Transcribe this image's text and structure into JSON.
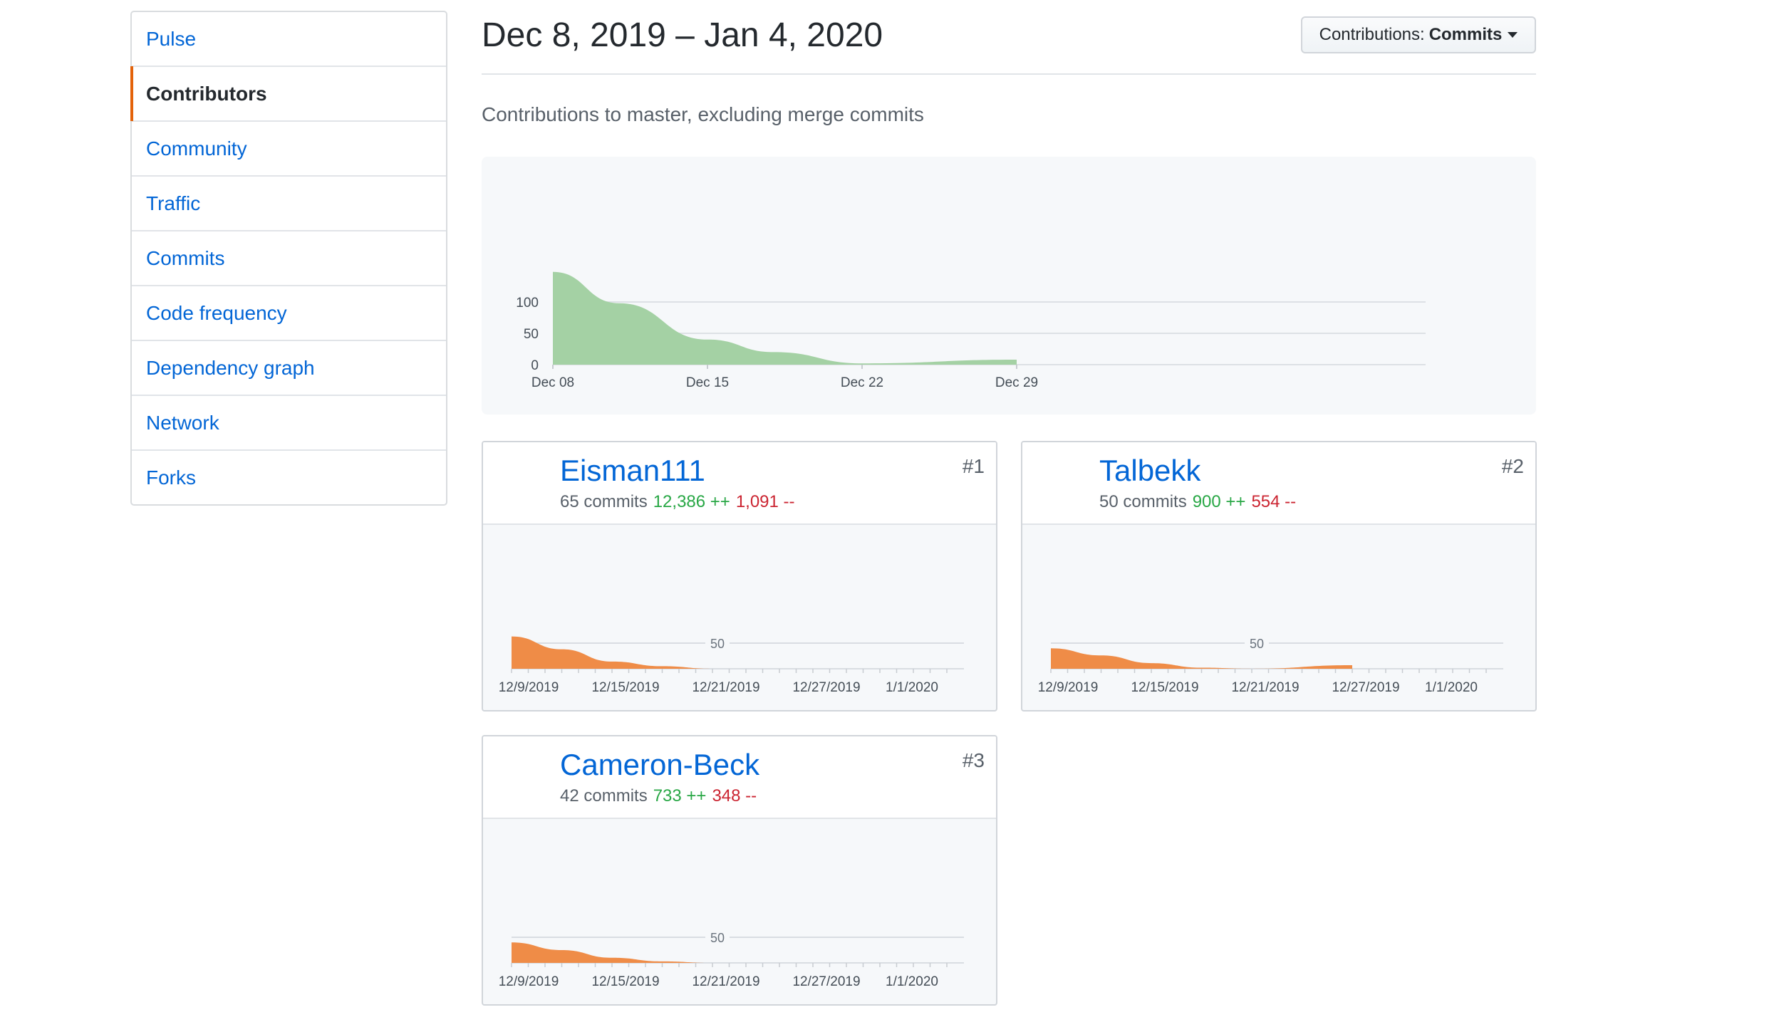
{
  "sidebar": {
    "items": [
      {
        "label": "Pulse",
        "name": "sidebar-item-pulse",
        "selected": false
      },
      {
        "label": "Contributors",
        "name": "sidebar-item-contributors",
        "selected": true
      },
      {
        "label": "Community",
        "name": "sidebar-item-community",
        "selected": false
      },
      {
        "label": "Traffic",
        "name": "sidebar-item-traffic",
        "selected": false
      },
      {
        "label": "Commits",
        "name": "sidebar-item-commits",
        "selected": false
      },
      {
        "label": "Code frequency",
        "name": "sidebar-item-code-frequency",
        "selected": false
      },
      {
        "label": "Dependency graph",
        "name": "sidebar-item-dependency-graph",
        "selected": false
      },
      {
        "label": "Network",
        "name": "sidebar-item-network",
        "selected": false
      },
      {
        "label": "Forks",
        "name": "sidebar-item-forks",
        "selected": false
      }
    ],
    "accent_color": "#e36209"
  },
  "header": {
    "date_range": "Dec 8, 2019 – Jan 4, 2020",
    "select_prefix": "Contributions:",
    "select_value": "Commits"
  },
  "subtitle": "Contributions to master, excluding merge commits",
  "colors": {
    "main_area": "#a4d1a4",
    "contributor_area": "#ef8c47",
    "link": "#0366d6",
    "additions": "#28a745",
    "deletions": "#cb2431"
  },
  "chart_data": [
    {
      "type": "area",
      "x_ticks": [
        "Dec 08",
        "Dec 15",
        "Dec 22",
        "Dec 29"
      ],
      "y_ticks": [
        "0",
        "50",
        "100"
      ],
      "ylim": [
        0,
        150
      ],
      "x": [
        0,
        3,
        7,
        10,
        14,
        21
      ],
      "values": [
        148,
        98,
        40,
        20,
        2,
        8
      ]
    },
    {
      "type": "area",
      "contributor": "Eisman111",
      "x_ticks": [
        "12/9/2019",
        "12/15/2019",
        "12/21/2019",
        "12/27/2019",
        "1/1/2020"
      ],
      "y_ticks": [
        "50"
      ],
      "ylim": [
        0,
        50
      ],
      "x": [
        0,
        3,
        6,
        9,
        12,
        24
      ],
      "values": [
        63,
        38,
        14,
        5,
        0,
        0
      ]
    },
    {
      "type": "area",
      "contributor": "Talbekk",
      "x_ticks": [
        "12/9/2019",
        "12/15/2019",
        "12/21/2019",
        "12/27/2019",
        "1/1/2020"
      ],
      "y_ticks": [
        "50"
      ],
      "ylim": [
        0,
        50
      ],
      "x": [
        0,
        3,
        6,
        9,
        12,
        18
      ],
      "values": [
        40,
        26,
        11,
        2,
        0,
        7
      ]
    },
    {
      "type": "area",
      "contributor": "Cameron-Beck",
      "x_ticks": [
        "12/9/2019",
        "12/15/2019",
        "12/21/2019",
        "12/27/2019",
        "1/1/2020"
      ],
      "y_ticks": [
        "50"
      ],
      "ylim": [
        0,
        50
      ],
      "x": [
        0,
        3,
        6,
        9,
        12,
        24
      ],
      "values": [
        40,
        25,
        10,
        3,
        0,
        0
      ]
    }
  ],
  "contributors": [
    {
      "login": "Eisman111",
      "commits": "65 commits",
      "additions": "12,386 ++",
      "deletions": "1,091 --",
      "rank": "#1",
      "avatar_icon": "photo-avatar-icon"
    },
    {
      "login": "Talbekk",
      "commits": "50 commits",
      "additions": "900 ++",
      "deletions": "554 --",
      "rank": "#2",
      "avatar_icon": "photo-avatar-icon"
    },
    {
      "login": "Cameron-Beck",
      "commits": "42 commits",
      "additions": "733 ++",
      "deletions": "348 --",
      "rank": "#3",
      "avatar_icon": "identicon-avatar-icon"
    }
  ]
}
